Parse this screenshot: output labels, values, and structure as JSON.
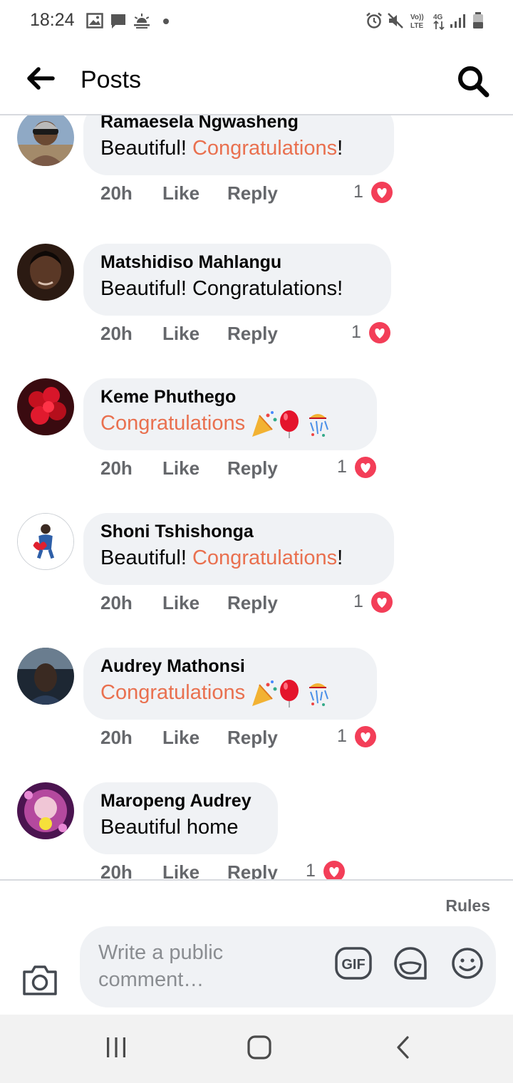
{
  "status_bar": {
    "time": "18:24",
    "left_icons": [
      "gallery-icon",
      "message-icon",
      "weather-icon"
    ],
    "right_icons": [
      "alarm-icon",
      "mute-icon",
      "volte-icon",
      "4g-icon",
      "signal-icon",
      "battery-icon"
    ],
    "volte_label_top": "Vo))",
    "volte_label_bottom": "LTE",
    "network_label": "4G"
  },
  "header": {
    "title": "Posts",
    "back_icon": "back-arrow-icon",
    "search_icon": "search-icon"
  },
  "actions": {
    "like": "Like",
    "reply": "Reply"
  },
  "comments": [
    {
      "author": "Ramaesela Ngwasheng",
      "text_before": "Beautiful! ",
      "text_highlight": "Congratulations",
      "text_after": "!",
      "emojis": "",
      "time": "20h",
      "reaction_count": "1",
      "reaction_icon": "heart-icon"
    },
    {
      "author": "Matshidiso Mahlangu",
      "text_before": "Beautiful! Congratulations!",
      "text_highlight": "",
      "text_after": "",
      "emojis": "",
      "time": "20h",
      "reaction_count": "1",
      "reaction_icon": "heart-icon"
    },
    {
      "author": "Keme Phuthego",
      "text_before": "",
      "text_highlight": "Congratulations",
      "text_after": "",
      "emojis": "party-popper balloon confetti-ball",
      "time": "20h",
      "reaction_count": "1",
      "reaction_icon": "heart-icon"
    },
    {
      "author": "Shoni Tshishonga",
      "text_before": "Beautiful! ",
      "text_highlight": "Congratulations",
      "text_after": "!",
      "emojis": "",
      "time": "20h",
      "reaction_count": "1",
      "reaction_icon": "heart-icon"
    },
    {
      "author": "Audrey Mathonsi",
      "text_before": "",
      "text_highlight": "Congratulations",
      "text_after": "",
      "emojis": "party-popper balloon confetti-ball",
      "time": "20h",
      "reaction_count": "1",
      "reaction_icon": "heart-icon"
    },
    {
      "author": "Maropeng Audrey",
      "text_before": "Beautiful home",
      "text_highlight": "",
      "text_after": "",
      "emojis": "",
      "time": "20h",
      "reaction_count": "1",
      "reaction_icon": "heart-icon"
    }
  ],
  "compose": {
    "rules_label": "Rules",
    "placeholder": "Write a public comment…",
    "gif_label": "GIF",
    "camera_icon": "camera-icon",
    "sticker_icon": "sticker-icon",
    "emoji_icon": "smiley-icon"
  },
  "nav_bar": {
    "icons": [
      "recents-icon",
      "home-icon",
      "back-icon"
    ]
  },
  "colors": {
    "highlight": "#e9704f",
    "bubble": "#f0f2f5",
    "secondary_text": "#65676b",
    "heart": "#f33e58"
  }
}
